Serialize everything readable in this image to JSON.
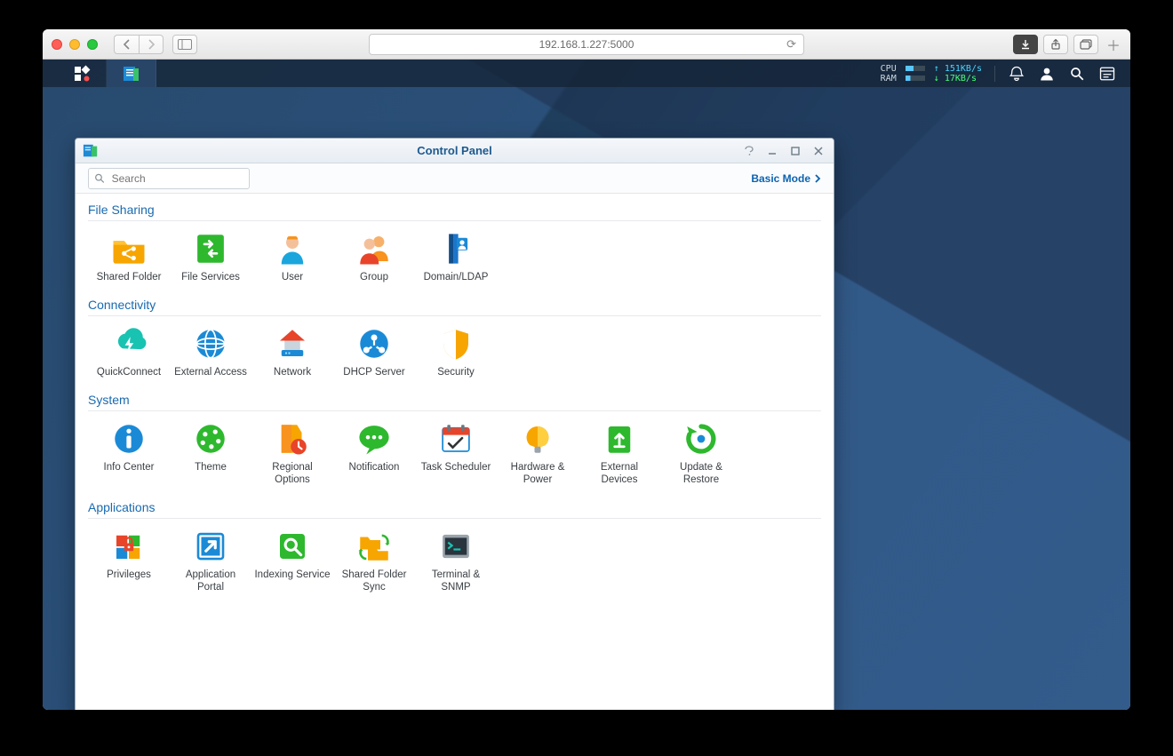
{
  "browser": {
    "url": "192.168.1.227:5000"
  },
  "dsm": {
    "stats": {
      "cpu_label": "CPU",
      "ram_label": "RAM",
      "up_label": "↑",
      "down_label": "↓",
      "up_rate": "151KB/s",
      "down_rate": "17KB/s"
    }
  },
  "control_panel": {
    "title": "Control Panel",
    "search_placeholder": "Search",
    "mode_label": "Basic Mode",
    "sections": {
      "file_sharing": {
        "title": "File Sharing",
        "items": [
          {
            "label": "Shared Folder"
          },
          {
            "label": "File Services"
          },
          {
            "label": "User"
          },
          {
            "label": "Group"
          },
          {
            "label": "Domain/LDAP"
          }
        ]
      },
      "connectivity": {
        "title": "Connectivity",
        "items": [
          {
            "label": "QuickConnect"
          },
          {
            "label": "External Access"
          },
          {
            "label": "Network"
          },
          {
            "label": "DHCP Server"
          },
          {
            "label": "Security"
          }
        ]
      },
      "system": {
        "title": "System",
        "items": [
          {
            "label": "Info Center"
          },
          {
            "label": "Theme"
          },
          {
            "label": "Regional Options"
          },
          {
            "label": "Notification"
          },
          {
            "label": "Task Scheduler"
          },
          {
            "label": "Hardware & Power"
          },
          {
            "label": "External Devices"
          },
          {
            "label": "Update & Restore"
          }
        ]
      },
      "applications": {
        "title": "Applications",
        "items": [
          {
            "label": "Privileges"
          },
          {
            "label": "Application Portal"
          },
          {
            "label": "Indexing Service"
          },
          {
            "label": "Shared Folder Sync"
          },
          {
            "label": "Terminal & SNMP"
          }
        ]
      }
    }
  }
}
